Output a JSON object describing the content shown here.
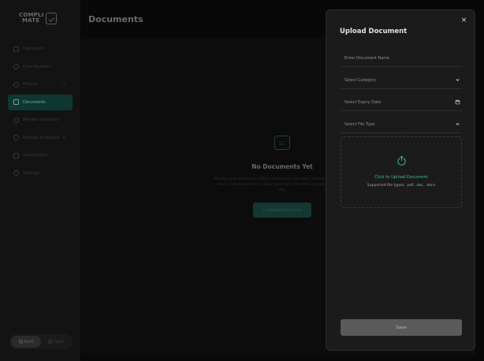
{
  "sidebar": {
    "logo": {
      "line1": "COMPLI",
      "line2": "MATE"
    },
    "items": [
      {
        "label": "Dashboard",
        "icon": "grid-icon",
        "chevron": false,
        "active": false
      },
      {
        "label": "Chat Assistant",
        "icon": "chat-icon",
        "chevron": false,
        "active": false
      },
      {
        "label": "Projects",
        "icon": "folder-icon",
        "chevron": true,
        "active": false
      },
      {
        "label": "Documents",
        "icon": "document-icon",
        "chevron": false,
        "active": true
      },
      {
        "label": "Manage Company",
        "icon": "user-icon",
        "chevron": false,
        "active": false
      },
      {
        "label": "Manage Employee",
        "icon": "users-icon",
        "chevron": true,
        "active": false
      },
      {
        "label": "Subscription",
        "icon": "card-icon",
        "chevron": false,
        "active": false
      },
      {
        "label": "Settings",
        "icon": "gear-icon",
        "chevron": false,
        "active": false
      }
    ],
    "theme": {
      "dark": "Dark",
      "light": "Light"
    }
  },
  "main": {
    "title": "Documents",
    "empty": {
      "title": "No Documents Yet",
      "description": "Manage your workplace safety documents with ease. Upload, organize, and share compliance files to keep your team informed and your workplace safe.",
      "button": "+ Upload Document"
    }
  },
  "modal": {
    "title": "Upload Document",
    "close": "×",
    "name_placeholder": "Enter Document Name",
    "category_label": "Select Category",
    "expiry_label": "Select Expiry Date",
    "filetype_label": "Select File Type",
    "upload_link": "Click to Upload Document",
    "upload_hint": "Supported file types: .pdf, .doc, .docx",
    "save": "Save"
  },
  "colors": {
    "accent": "#3fb6a8",
    "active_nav": "#154a45",
    "panel": "#1b1b1b"
  }
}
